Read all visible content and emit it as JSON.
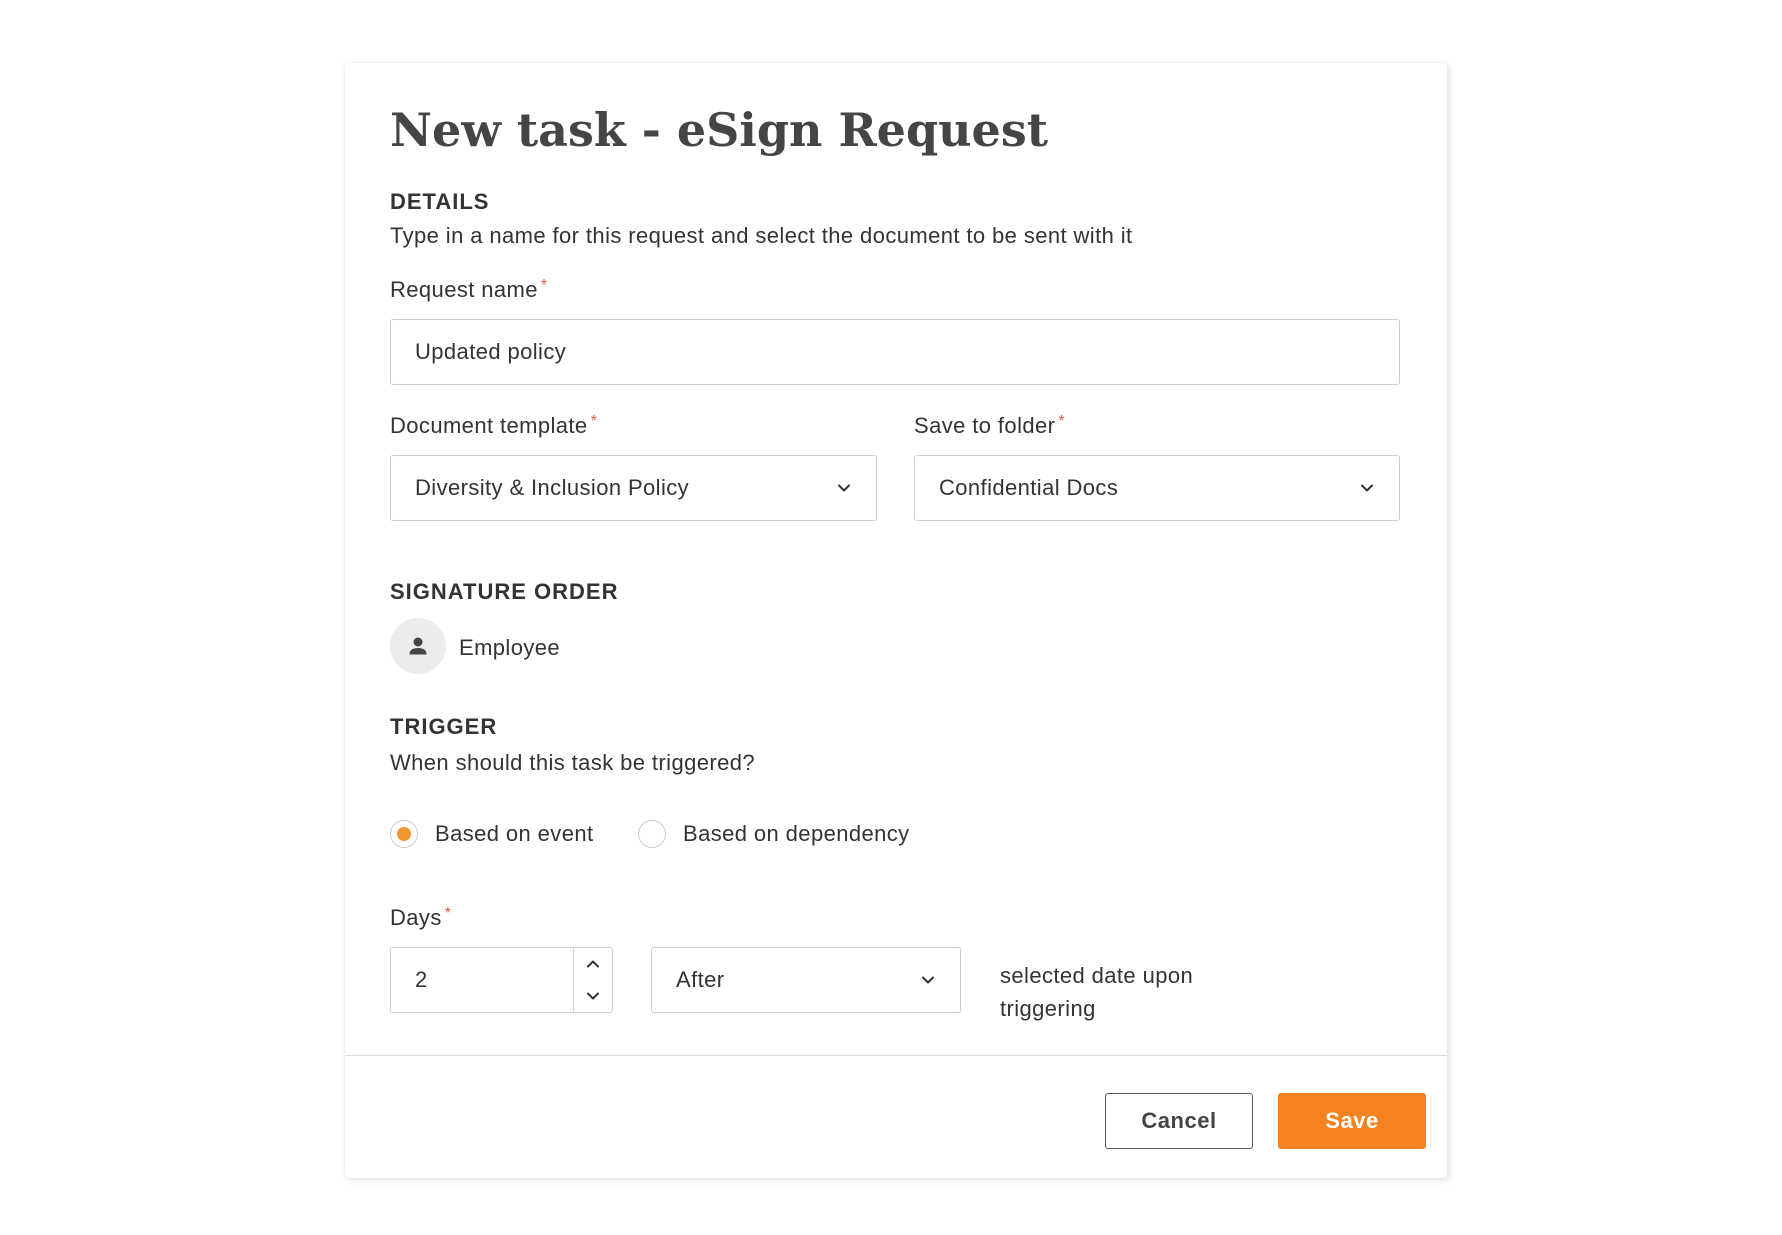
{
  "dialog": {
    "title": "New task - eSign Request",
    "details": {
      "heading": "DETAILS",
      "description": "Type in a name for this request and select the document to be sent with it",
      "request_name": {
        "label": "Request name",
        "required_mark": "*",
        "value": "Updated policy"
      },
      "document_template": {
        "label": "Document template",
        "required_mark": "*",
        "value": "Diversity & Inclusion Policy"
      },
      "save_to_folder": {
        "label": "Save to folder",
        "required_mark": "*",
        "value": "Confidential Docs"
      }
    },
    "signature_order": {
      "heading": "SIGNATURE ORDER",
      "signers": [
        {
          "name": "Employee",
          "icon": "person-icon"
        }
      ]
    },
    "trigger": {
      "heading": "TRIGGER",
      "question": "When should this task be triggered?",
      "options": [
        {
          "label": "Based on event",
          "selected": true
        },
        {
          "label": "Based on dependency",
          "selected": false
        }
      ],
      "days": {
        "label": "Days",
        "required_mark": "*",
        "value": "2"
      },
      "timing": {
        "value": "After"
      },
      "suffix_line1": "selected date upon",
      "suffix_line2": "triggering"
    },
    "footer": {
      "cancel_label": "Cancel",
      "save_label": "Save"
    }
  },
  "colors": {
    "accent": "#f58220",
    "radio_selected": "#f0952f",
    "required": "#e25b45"
  }
}
